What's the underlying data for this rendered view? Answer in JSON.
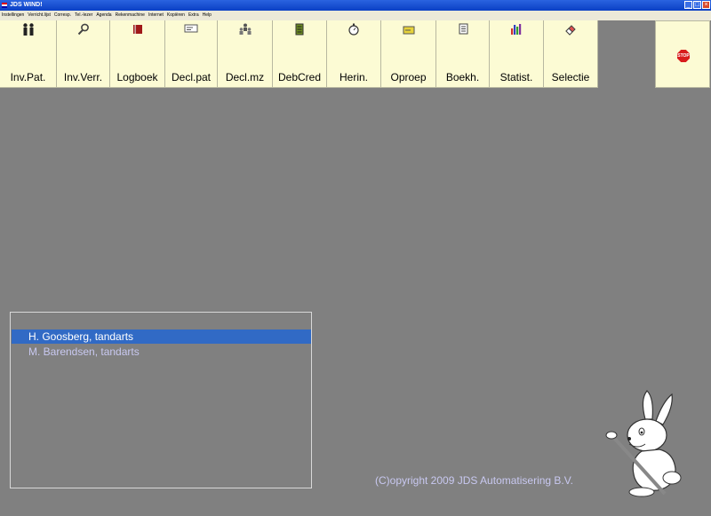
{
  "window": {
    "title": "JDS WIND!"
  },
  "menu": [
    "Instellingen",
    "Verricht.lijst",
    "Corresp.",
    "Tel.-lezer",
    "Agenda",
    "Rekenmachine",
    "Internet",
    "Kopiëren",
    "Extra",
    "Help"
  ],
  "toolbar": [
    {
      "label": "Inv.Pat.",
      "icon": "people-icon"
    },
    {
      "label": "Inv.Verr.",
      "icon": "magnifier-icon"
    },
    {
      "label": "Logboek",
      "icon": "book-icon"
    },
    {
      "label": "Decl.pat",
      "icon": "card-icon"
    },
    {
      "label": "Decl.mz",
      "icon": "group-icon"
    },
    {
      "label": "DebCred",
      "icon": "ledger-icon"
    },
    {
      "label": "Herin.",
      "icon": "stopwatch-icon"
    },
    {
      "label": "Oproep",
      "icon": "envelope-icon"
    },
    {
      "label": "Boekh.",
      "icon": "notepad-icon"
    },
    {
      "label": "Statist.",
      "icon": "bar-chart-icon"
    },
    {
      "label": "Selectie",
      "icon": "eraser-icon"
    }
  ],
  "stop_button": {
    "label": "STOP",
    "icon": "stop-sign-icon"
  },
  "users": [
    {
      "name": "H. Goosberg, tandarts",
      "selected": true
    },
    {
      "name": "M. Barendsen, tandarts",
      "selected": false
    }
  ],
  "copyright": "(C)opyright 2009 JDS Automatisering B.V.",
  "colors": {
    "background": "#808080",
    "toolbar": "#fcfbd4",
    "selection": "#316ac5",
    "accent_text": "#c8c8f0"
  }
}
